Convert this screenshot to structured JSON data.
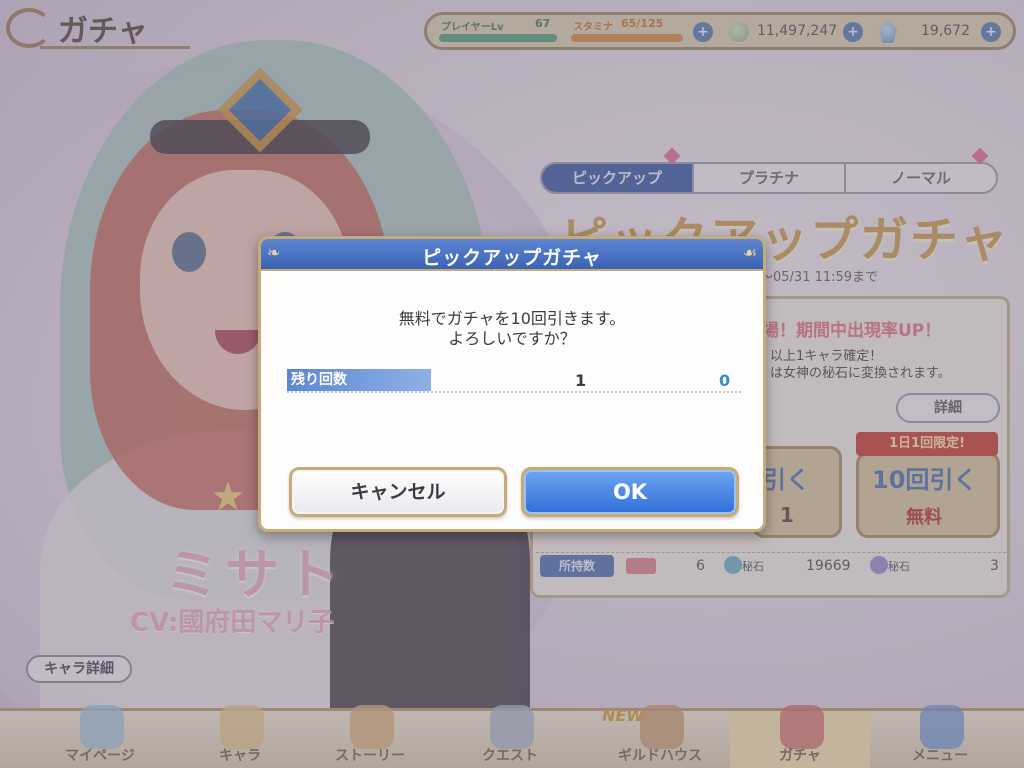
{
  "header": {
    "title": "ガチャ"
  },
  "status": {
    "rank_label": "プレイヤーLv",
    "level": "67",
    "stamina_label": "スタミナ",
    "stamina": "65/125",
    "mana": "11,497,247",
    "jewels": "19,672",
    "plus": "+"
  },
  "gacha_tabs": [
    {
      "label": "ピックアップ",
      "active": true
    },
    {
      "label": "プラチナ",
      "active": false
    },
    {
      "label": "ノーマル",
      "active": false
    }
  ],
  "banner": {
    "title": "ピックアップガチャ",
    "date": "～05/31 11:59まで",
    "headline": "場！期間中出現率UP！",
    "line1": "以上1キャラ確定！",
    "line2": "は女神の秘石に変換されます。",
    "detail_label": "詳細",
    "draw_once_label": "引く",
    "draw_once_cost": "1",
    "limit_badge": "1日1回限定!",
    "draw_ten_label": "10回引く",
    "draw_ten_cost": "無料"
  },
  "owned": {
    "label": "所持数",
    "tickets": "6",
    "gem_caption": "秘石",
    "jewels": "19669",
    "gem2_caption": "秘石",
    "third": "3"
  },
  "character": {
    "name": "ミサト",
    "cv": "CV:國府田マリ子",
    "detail_label": "キャラ詳細"
  },
  "bottom_nav": [
    {
      "label": "マイページ",
      "icon": "home-icon",
      "active": false
    },
    {
      "label": "キャラ",
      "icon": "character-icon",
      "active": false
    },
    {
      "label": "ストーリー",
      "icon": "scroll-icon",
      "active": false
    },
    {
      "label": "クエスト",
      "icon": "sword-icon",
      "active": false
    },
    {
      "label": "ギルドハウス",
      "icon": "guild-house-icon",
      "active": false
    },
    {
      "label": "ガチャ",
      "icon": "gacha-icon",
      "active": true
    },
    {
      "label": "メニュー",
      "icon": "crystal-icon",
      "active": false
    }
  ],
  "nav_new_badge": "NEW",
  "dialog": {
    "title": "ピックアップガチャ",
    "message_line1": "無料でガチャを10回引きます。",
    "message_line2": "よろしいですか？",
    "remaining_label": "残り回数",
    "remaining_before": "1",
    "remaining_after": "0",
    "cancel_label": "キャンセル",
    "ok_label": "OK"
  },
  "colors": {
    "dialog_header": "#3a63b6",
    "ok_button": "#2f6fd8",
    "gold_border": "#c7ab77",
    "remaining_after": "#3a8ed0"
  }
}
